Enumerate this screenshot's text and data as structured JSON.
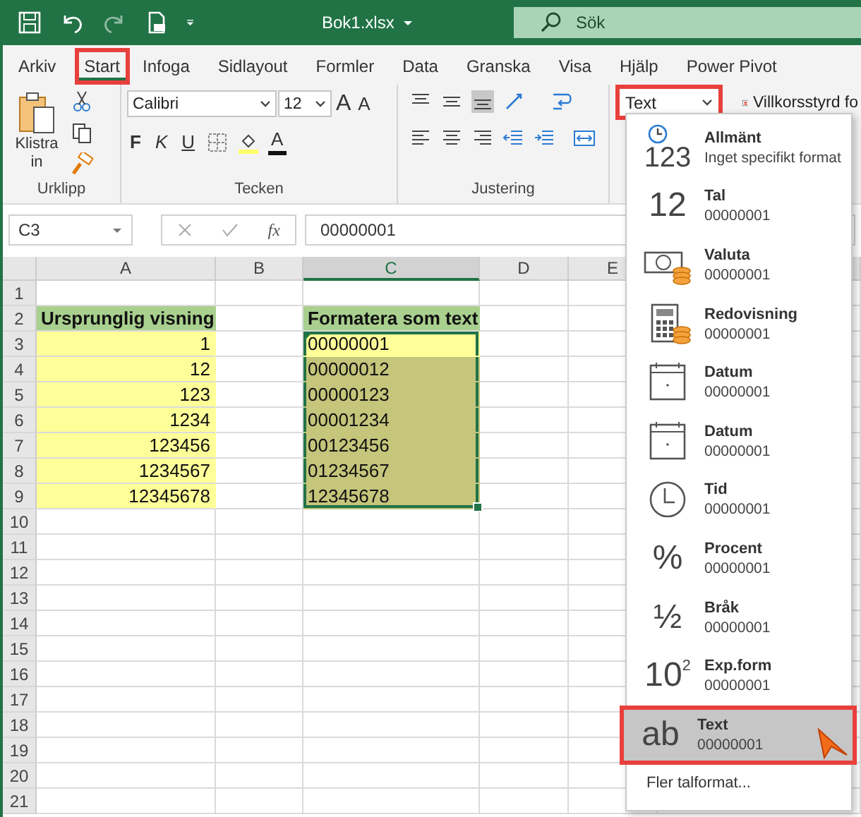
{
  "title_bar": {
    "title": "Bok1.xlsx",
    "search": {
      "placeholder": "Sök"
    }
  },
  "ribbon_tabs": [
    {
      "label": "Arkiv",
      "selected": false,
      "highlighted": false
    },
    {
      "label": "Start",
      "selected": true,
      "highlighted": true
    },
    {
      "label": "Infoga",
      "selected": false,
      "highlighted": false
    },
    {
      "label": "Sidlayout",
      "selected": false,
      "highlighted": false
    },
    {
      "label": "Formler",
      "selected": false,
      "highlighted": false
    },
    {
      "label": "Data",
      "selected": false,
      "highlighted": false
    },
    {
      "label": "Granska",
      "selected": false,
      "highlighted": false
    },
    {
      "label": "Visa",
      "selected": false,
      "highlighted": false
    },
    {
      "label": "Hjälp",
      "selected": false,
      "highlighted": false
    },
    {
      "label": "Power Pivot",
      "selected": false,
      "highlighted": false
    }
  ],
  "ribbon": {
    "paste_label": "Klistra in",
    "font_name": "Calibri",
    "font_size": "12",
    "grow_label": "A",
    "shrink_label": "A",
    "style_buttons": [
      "F",
      "K",
      "U"
    ],
    "font_color_label": "A",
    "groups": [
      "Urklipp",
      "Tecken",
      "Justering"
    ],
    "number_format": {
      "value": "Text",
      "highlighted": true
    },
    "conditional_formatting": "Villkorsstyrd fo"
  },
  "formula_bar": {
    "cell_ref": "C3",
    "fx": "fx",
    "value": "00000001"
  },
  "sheet": {
    "columns": [
      {
        "label": "A",
        "selected": false
      },
      {
        "label": "B",
        "selected": false
      },
      {
        "label": "C",
        "selected": true
      },
      {
        "label": "D",
        "selected": false
      },
      {
        "label": "E",
        "selected": false
      }
    ],
    "rows": [
      {
        "number": "1"
      },
      {
        "number": "2",
        "a": {
          "text": "Ursprunglig visning",
          "kind": "header"
        },
        "c": {
          "text": "Formatera som text",
          "kind": "header",
          "selected": false,
          "active": false
        }
      },
      {
        "number": "3",
        "a": {
          "text": "1",
          "kind": "value"
        },
        "c": {
          "text": "00000001",
          "kind": "value",
          "selected": true,
          "active": true
        }
      },
      {
        "number": "4",
        "a": {
          "text": "12",
          "kind": "value"
        },
        "c": {
          "text": "00000012",
          "kind": "value",
          "selected": true,
          "active": false
        }
      },
      {
        "number": "5",
        "a": {
          "text": "123",
          "kind": "value"
        },
        "c": {
          "text": "00000123",
          "kind": "value",
          "selected": true,
          "active": false
        }
      },
      {
        "number": "6",
        "a": {
          "text": "1234",
          "kind": "value"
        },
        "c": {
          "text": "00001234",
          "kind": "value",
          "selected": true,
          "active": false
        }
      },
      {
        "number": "7",
        "a": {
          "text": "123456",
          "kind": "value"
        },
        "c": {
          "text": "00123456",
          "kind": "value",
          "selected": true,
          "active": false
        }
      },
      {
        "number": "8",
        "a": {
          "text": "1234567",
          "kind": "value"
        },
        "c": {
          "text": "01234567",
          "kind": "value",
          "selected": true,
          "active": false
        }
      },
      {
        "number": "9",
        "a": {
          "text": "12345678",
          "kind": "value"
        },
        "c": {
          "text": "12345678",
          "kind": "value",
          "selected": true,
          "active": false
        }
      },
      {
        "number": "10"
      },
      {
        "number": "11"
      },
      {
        "number": "12"
      },
      {
        "number": "13"
      },
      {
        "number": "14"
      },
      {
        "number": "15"
      },
      {
        "number": "16"
      },
      {
        "number": "17"
      },
      {
        "number": "18"
      },
      {
        "number": "19"
      },
      {
        "number": "20"
      },
      {
        "number": "21"
      }
    ]
  },
  "format_menu": {
    "items": [
      {
        "kind": "general",
        "glyph": "123",
        "name": "Allmänt",
        "sample": "Inget specifikt format",
        "selected": false,
        "highlighted": false
      },
      {
        "kind": "number",
        "glyph": "12",
        "name": "Tal",
        "sample": "00000001",
        "selected": false,
        "highlighted": false
      },
      {
        "kind": "currency",
        "name": "Valuta",
        "sample": "00000001",
        "selected": false,
        "highlighted": false
      },
      {
        "kind": "accounting",
        "name": "Redovisning",
        "sample": "00000001",
        "selected": false,
        "highlighted": false
      },
      {
        "kind": "date",
        "name": "Datum",
        "sample": "00000001",
        "selected": false,
        "highlighted": false
      },
      {
        "kind": "date",
        "name": "Datum",
        "sample": "00000001",
        "selected": false,
        "highlighted": false
      },
      {
        "kind": "time",
        "name": "Tid",
        "sample": "00000001",
        "selected": false,
        "highlighted": false
      },
      {
        "kind": "percent",
        "glyph": "%",
        "name": "Procent",
        "sample": "00000001",
        "selected": false,
        "highlighted": false
      },
      {
        "kind": "fraction",
        "glyph": "½",
        "name": "Bråk",
        "sample": "00000001",
        "selected": false,
        "highlighted": false
      },
      {
        "kind": "scientific",
        "glyph": "10$^{2}$",
        "name": "Exp.form",
        "sample": "00000001",
        "selected": false,
        "highlighted": false
      },
      {
        "kind": "text",
        "glyph": "ab",
        "name": "Text",
        "sample": "00000001",
        "selected": true,
        "highlighted": true
      }
    ],
    "footer": "Fler talformat..."
  }
}
